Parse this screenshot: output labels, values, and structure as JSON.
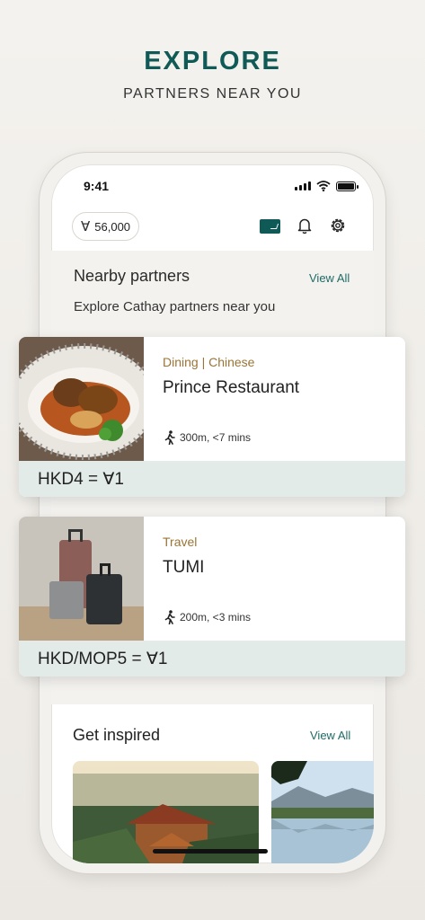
{
  "hero": {
    "title": "EXPLORE",
    "subtitle": "PARTNERS NEAR YOU"
  },
  "status_bar": {
    "time": "9:41"
  },
  "header": {
    "points": "56,000",
    "points_symbol": "Ɐ"
  },
  "nearby": {
    "title": "Nearby partners",
    "view_all": "View All",
    "subtitle": "Explore Cathay partners near you",
    "partners": [
      {
        "category": "Dining | Chinese",
        "name": "Prince Restaurant",
        "distance": "300m, <7 mins",
        "rate": "HKD4 = Ɐ1"
      },
      {
        "category": "Travel",
        "name": "TUMI",
        "distance": "200m, <3 mins",
        "rate": "HKD/MOP5 = Ɐ1"
      }
    ]
  },
  "inspire": {
    "title": "Get inspired",
    "view_all": "View All"
  },
  "colors": {
    "brand": "#0f5a56",
    "accent_gold": "#9a7437",
    "rate_band": "#e3ebe9"
  }
}
